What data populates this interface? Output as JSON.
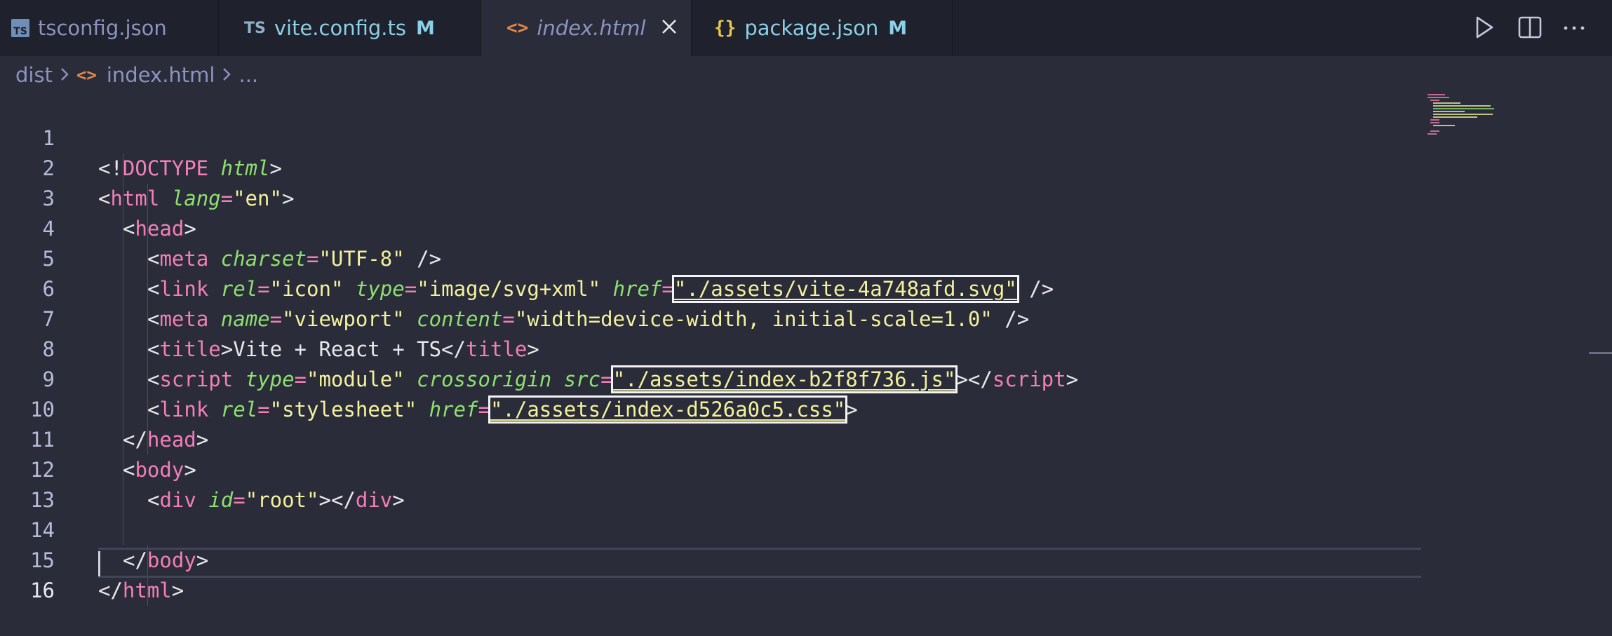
{
  "tabs": [
    {
      "label": "tsconfig.json",
      "icon": "typescript-config-icon",
      "badge": "TS",
      "modified": "",
      "active": false
    },
    {
      "label": "vite.config.ts",
      "icon": "typescript-file-icon",
      "badge": "TS",
      "modified": "M",
      "active": false
    },
    {
      "label": "index.html",
      "icon": "html-file-icon",
      "badge": "<>",
      "modified": "",
      "active": true
    },
    {
      "label": "package.json",
      "icon": "json-file-icon",
      "badge": "{}",
      "modified": "M",
      "active": false
    }
  ],
  "toolbar": {
    "run": "run-icon",
    "split": "split-editor-icon",
    "more": "more-icon"
  },
  "breadcrumb": {
    "folder": "dist",
    "file": "index.html",
    "more": "..."
  },
  "editor": {
    "line_numbers": [
      "1",
      "2",
      "3",
      "4",
      "5",
      "6",
      "7",
      "8",
      "9",
      "10",
      "11",
      "12",
      "13",
      "14",
      "15",
      "16"
    ],
    "current_line": "16",
    "lines": {
      "l1": {
        "open": "<!",
        "kw": "DOCTYPE",
        "attr": "html",
        "close": ">"
      },
      "l2": {
        "open": "<",
        "tag": "html",
        "attr": "lang",
        "eq": "=",
        "val": "\"en\"",
        "close": ">"
      },
      "l3": {
        "open": "<",
        "tag": "head",
        "close": ">"
      },
      "l4": {
        "open": "<",
        "tag": "meta",
        "attr": "charset",
        "eq": "=",
        "val": "\"UTF-8\"",
        "close": " />"
      },
      "l5": {
        "open": "<",
        "tag": "link",
        "a1": "rel",
        "v1": "\"icon\"",
        "a2": "type",
        "v2": "\"image/svg+xml\"",
        "a3": "href",
        "v3": "\"./assets/vite-4a748afd.svg\"",
        "close": " />"
      },
      "l6": {
        "open": "<",
        "tag": "meta",
        "a1": "name",
        "v1": "\"viewport\"",
        "a2": "content",
        "v2": "\"width=device-width, initial-scale=1.0\"",
        "close": " />"
      },
      "l7": {
        "open": "<",
        "tag": "title",
        "mid": ">Vite + React + TS</",
        "tag2": "title",
        "close": ">"
      },
      "l8": {
        "open": "<",
        "tag": "script",
        "a1": "type",
        "v1": "\"module\"",
        "a2": "crossorigin",
        "a3": "src",
        "v3": "\"./assets/index-b2f8f736.js\"",
        "mid": "></",
        "tag2": "script",
        "close": ">"
      },
      "l9": {
        "open": "<",
        "tag": "link",
        "a1": "rel",
        "v1": "\"stylesheet\"",
        "a2": "href",
        "v2": "\"./assets/index-d526a0c5.css\"",
        "close": ">"
      },
      "l10": {
        "open": "</",
        "tag": "head",
        "close": ">"
      },
      "l11": {
        "open": "<",
        "tag": "body",
        "close": ">"
      },
      "l12": {
        "open": "<",
        "tag": "div",
        "attr": "id",
        "eq": "=",
        "val": "\"root\"",
        "mid": "></",
        "tag2": "div",
        "close": ">"
      },
      "l14": {
        "open": "</",
        "tag": "body",
        "close": ">"
      },
      "l15": {
        "open": "</",
        "tag": "html",
        "close": ">"
      }
    },
    "highlighted_values": [
      "./assets/vite-4a748afd.svg",
      "./assets/index-b2f8f736.js",
      "./assets/index-d526a0c5.css"
    ]
  },
  "colors": {
    "background": "#2a2c3a",
    "tab_bar": "#1f212c",
    "tag": "#f37fb6",
    "attribute": "#8ee06e",
    "string": "#f4f19c",
    "modified_badge": "#8bd0e6",
    "html_icon": "#e2884a",
    "json_icon": "#e6c94a"
  }
}
